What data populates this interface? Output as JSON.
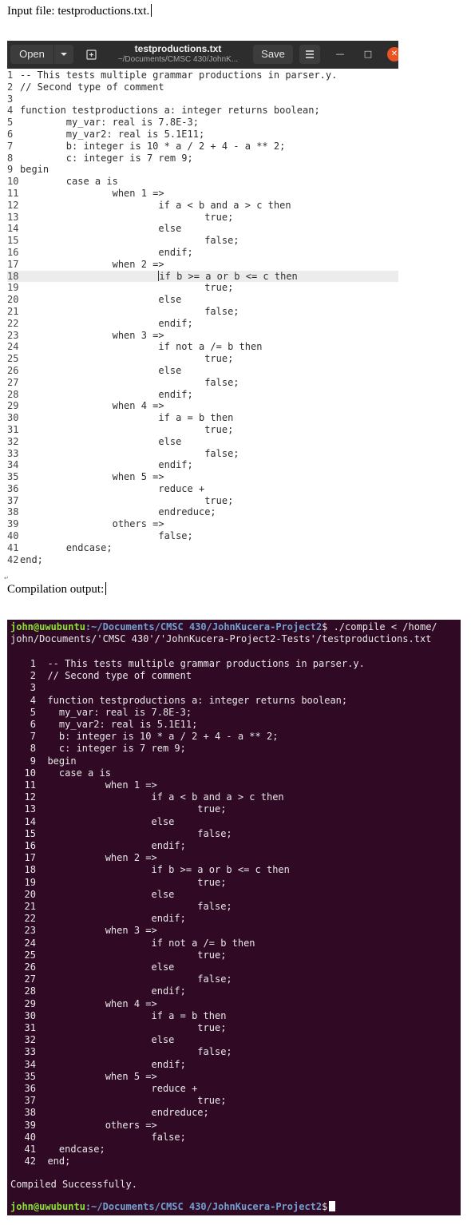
{
  "labels": {
    "input_file": "Input file: testproductions.txt.",
    "compilation_output": "Compilation output:"
  },
  "editor": {
    "open_label": "Open",
    "save_label": "Save",
    "title": "testproductions.txt",
    "subtitle": "~/Documents/CMSC 430/JohnK...",
    "current_line": 18,
    "lines": [
      "-- This tests multiple grammar productions in parser.y.",
      "// Second type of comment",
      "",
      "function testproductions a: integer returns boolean;",
      "        my_var: real is 7.8E-3;",
      "        my_var2: real is 5.1E11;",
      "        b: integer is 10 * a / 2 + 4 - a ** 2;",
      "        c: integer is 7 rem 9;",
      "begin",
      "        case a is",
      "                when 1 =>",
      "                        if a < b and a > c then",
      "                                true;",
      "                        else",
      "                                false;",
      "                        endif;",
      "                when 2 =>",
      "                        if b >= a or b <= c then",
      "                                true;",
      "                        else",
      "                                false;",
      "                        endif;",
      "                when 3 =>",
      "                        if not a /= b then",
      "                                true;",
      "                        else",
      "                                false;",
      "                        endif;",
      "                when 4 =>",
      "                        if a = b then",
      "                                true;",
      "                        else",
      "                                false;",
      "                        endif;",
      "                when 5 =>",
      "                        reduce +",
      "                                true;",
      "                        endreduce;",
      "                others =>",
      "                        false;",
      "        endcase;",
      "end;"
    ]
  },
  "terminal": {
    "prompt_user": "john@uwubuntu",
    "prompt_path": ":~/Documents/CMSC 430/JohnKucera-Project2",
    "prompt_symbol": "$",
    "command_line1": " ./compile < /home/",
    "command_line2": "john/Documents/'CMSC 430'/'JohnKucera-Project2-Tests'/testproductions.txt",
    "listing": [
      "-- This tests multiple grammar productions in parser.y.",
      "// Second type of comment",
      "",
      "function testproductions a: integer returns boolean;",
      "  my_var: real is 7.8E-3;",
      "  my_var2: real is 5.1E11;",
      "  b: integer is 10 * a / 2 + 4 - a ** 2;",
      "  c: integer is 7 rem 9;",
      "begin",
      "  case a is",
      "          when 1 =>",
      "                  if a < b and a > c then",
      "                          true;",
      "                  else",
      "                          false;",
      "                  endif;",
      "          when 2 =>",
      "                  if b >= a or b <= c then",
      "                          true;",
      "                  else",
      "                          false;",
      "                  endif;",
      "          when 3 =>",
      "                  if not a /= b then",
      "                          true;",
      "                  else",
      "                          false;",
      "                  endif;",
      "          when 4 =>",
      "                  if a = b then",
      "                          true;",
      "                  else",
      "                          false;",
      "                  endif;",
      "          when 5 =>",
      "                  reduce +",
      "                          true;",
      "                  endreduce;",
      "          others =>",
      "                  false;",
      "  endcase;",
      "end;"
    ],
    "status": "Compiled Successfully."
  }
}
